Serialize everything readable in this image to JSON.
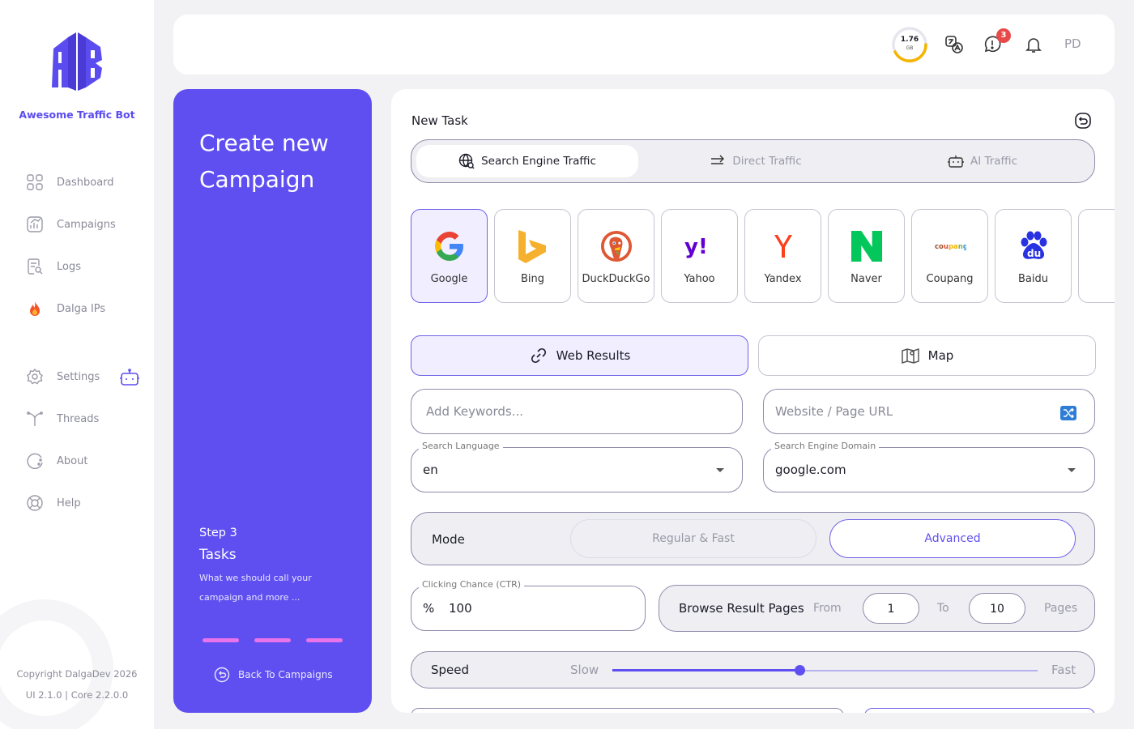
{
  "sidebar": {
    "brand": "Awesome Traffic Bot",
    "items": [
      {
        "label": "Dashboard",
        "icon": "dashboard-icon"
      },
      {
        "label": "Campaigns",
        "icon": "campaigns-icon"
      },
      {
        "label": "Logs",
        "icon": "logs-icon"
      },
      {
        "label": "Dalga IPs",
        "icon": "fire-icon"
      },
      {
        "label": "Settings",
        "icon": "gear-icon"
      },
      {
        "label": "Threads",
        "icon": "threads-icon"
      },
      {
        "label": "About",
        "icon": "about-icon"
      },
      {
        "label": "Help",
        "icon": "lifebuoy-icon"
      }
    ],
    "copyright": "Copyright DalgaDev 2026",
    "version": "UI 2.1.0 | Core 2.2.0.0"
  },
  "topbar": {
    "data_usage": "1.76",
    "data_unit": "GB",
    "alert_count": "3",
    "user_initials": "PD"
  },
  "campaign_panel": {
    "title": "Create new Campaign",
    "step": "Step 3",
    "step_title": "Tasks",
    "step_description": "What we should call your campaign and more ...",
    "back_label": "Back To Campaigns"
  },
  "task": {
    "title": "New Task",
    "tabs": [
      {
        "label": "Search Engine Traffic",
        "icon": "globe-search-icon",
        "active": true
      },
      {
        "label": "Direct Traffic",
        "icon": "arrows-right-icon",
        "active": false
      },
      {
        "label": "AI Traffic",
        "icon": "robot-icon",
        "active": false
      }
    ],
    "engines": [
      {
        "name": "Google",
        "active": true
      },
      {
        "name": "Bing"
      },
      {
        "name": "DuckDuckGo"
      },
      {
        "name": "Yahoo"
      },
      {
        "name": "Yandex"
      },
      {
        "name": "Naver"
      },
      {
        "name": "Coupang"
      },
      {
        "name": "Baidu"
      }
    ],
    "result_types": [
      {
        "label": "Web Results",
        "icon": "link-icon",
        "active": true
      },
      {
        "label": "Map",
        "icon": "map-icon",
        "active": false
      }
    ],
    "keywords_placeholder": "Add Keywords...",
    "url_placeholder": "Website / Page URL",
    "search_language": {
      "label": "Search Language",
      "value": "en"
    },
    "search_domain": {
      "label": "Search Engine Domain",
      "value": "google.com"
    },
    "mode": {
      "label": "Mode",
      "options": [
        "Regular & Fast",
        "Advanced"
      ],
      "selected": "Advanced"
    },
    "ctr": {
      "label": "Clicking Chance (CTR)",
      "prefix": "%",
      "value": "100"
    },
    "browse": {
      "label": "Browse Result Pages",
      "from_label": "From",
      "from_value": "1",
      "to_label": "To",
      "to_value": "10",
      "suffix": "Pages"
    },
    "speed": {
      "label": "Speed",
      "min_label": "Slow",
      "max_label": "Fast",
      "value_fraction": 0.44
    }
  },
  "colors": {
    "accent": "#5f4ff0",
    "alert": "#e84a4a",
    "progress": "#f4b400"
  }
}
